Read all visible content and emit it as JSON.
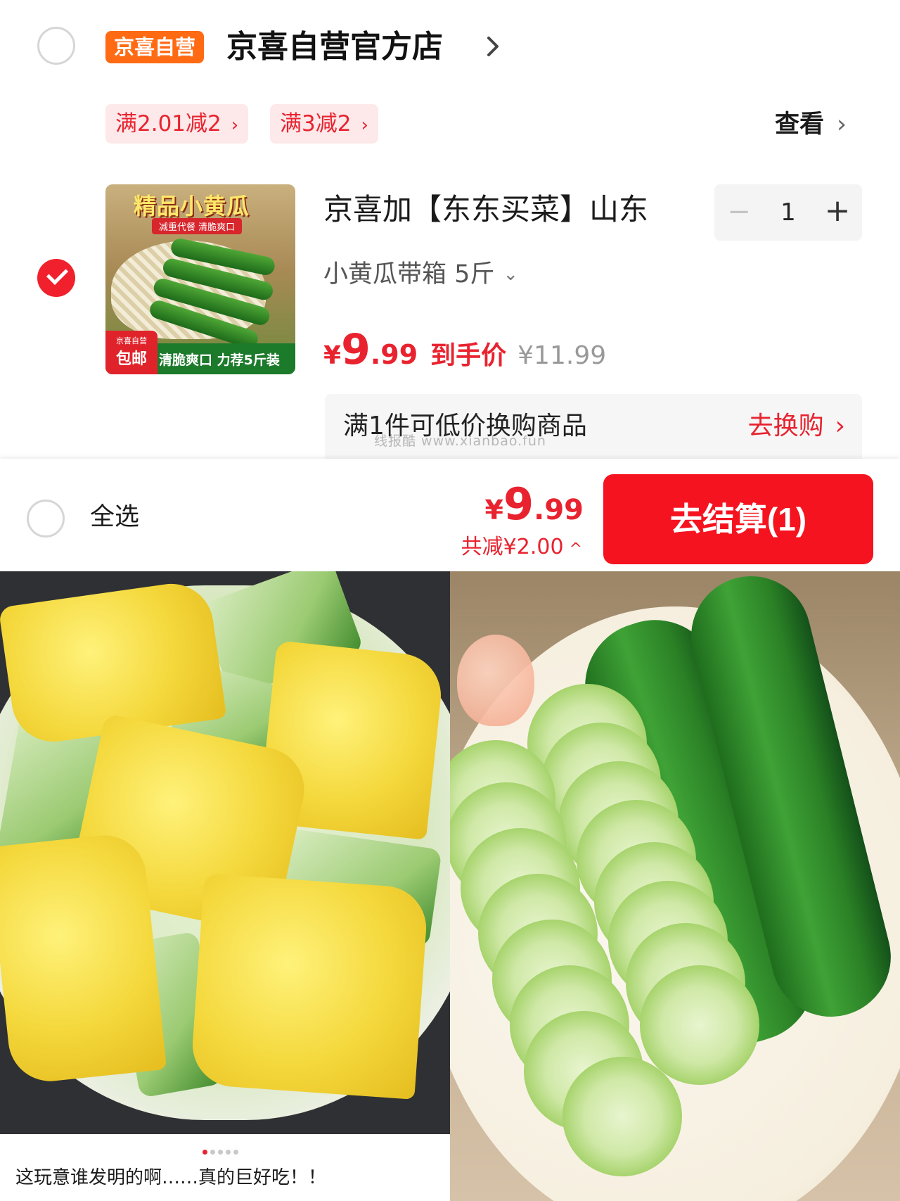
{
  "store": {
    "badge": "京喜自营",
    "name": "京喜自营官方店",
    "arrow": "›"
  },
  "promotions": [
    {
      "label": "满2.01减2",
      "chevron": "›"
    },
    {
      "label": "满3减2",
      "chevron": "›"
    }
  ],
  "view_more": {
    "label": "查看",
    "chevron": "›"
  },
  "product": {
    "thumbnail": {
      "title": "精品小黄瓜",
      "subtitle": "减重代餐 清脆爽口",
      "badge_small": "京喜自营",
      "badge_large": "包邮",
      "tagline": "清脆爽口 力荐5斤装"
    },
    "title": "京喜加【东东买菜】山东",
    "spec": "小黄瓜带箱 5斤",
    "spec_caret": "⌄",
    "price": {
      "yen": "¥",
      "int": "9",
      "dec": ".99",
      "label": "到手价",
      "original": "¥11.99"
    },
    "quantity": {
      "minus": "−",
      "value": "1",
      "plus": "+"
    },
    "selected": true
  },
  "swap": {
    "text": "满1件可低价换购商品",
    "link": "去换购",
    "chevron": "›"
  },
  "watermark": "线报酷 www.xianbao.fun",
  "footer": {
    "select_all": "全选",
    "total": {
      "yen": "¥",
      "int": "9",
      "dec": ".99"
    },
    "saved": "共减¥2.00",
    "saved_caret": "^",
    "checkout": "去结算(1)"
  },
  "post": {
    "caption": "这玩意谁发明的啊……真的巨好吃！！",
    "pager_count": 5,
    "pager_active": 1
  },
  "colors": {
    "accent_red": "#e8232f",
    "badge_orange": "#ff6a13",
    "promo_bg": "#fde8ea"
  }
}
